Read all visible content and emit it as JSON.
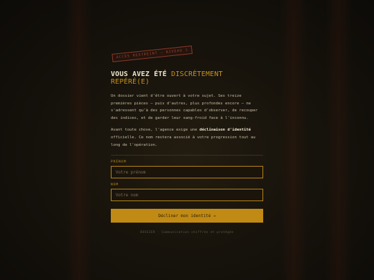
{
  "stamp": "Accès restreint — Niveau 1",
  "heading": {
    "prefix": "VOUS AVEZ ÉTÉ",
    "accent": "DISCRÈTEMENT REPÉRÉ(E)"
  },
  "intro": {
    "paragraph1": "Un dossier vient d'être ouvert à votre sujet. Ses treize premières pièces — puis d'autres, plus profondes encore — ne s'adressent qu'à des personnes capables d'observer, de recouper des indices, et de garder leur sang-froid face à l'inconnu.",
    "paragraph2_before": "Avant toute chose, l'agence exige une ",
    "paragraph2_strong": "déclinaison d'identité",
    "paragraph2_after": " officielle. Ce nom restera associé à votre progression tout au long de l'opération."
  },
  "form": {
    "firstname_label": "Prénom",
    "firstname_placeholder": "Votre prénom",
    "firstname_value": "",
    "lastname_label": "Nom",
    "lastname_placeholder": "Votre nom",
    "lastname_value": "",
    "submit_label": "Décliner mon identité →"
  },
  "footer": "DOSSIER · Communication chiffrée et protégée",
  "colors": {
    "accent": "#c8931c",
    "background": "#17130c",
    "stamp": "#9a4632"
  }
}
